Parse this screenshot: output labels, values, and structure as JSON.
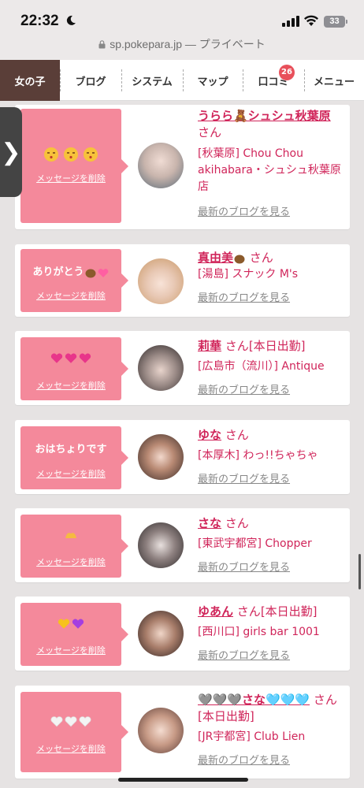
{
  "status": {
    "time": "22:32",
    "battery": "33"
  },
  "browser": {
    "url": "sp.pokepara.jp",
    "privacy": "— プライベート"
  },
  "nav": {
    "items": [
      {
        "label": "女の子"
      },
      {
        "label": "ブログ"
      },
      {
        "label": "システム"
      },
      {
        "label": "マップ"
      },
      {
        "label": "口コミ",
        "badge": "26"
      },
      {
        "label": "メニュー"
      }
    ]
  },
  "drawer": {
    "label": "❯"
  },
  "cards": [
    {
      "message": "",
      "delete_label": "メッセージを削除",
      "name": "うらら🧸シュシュ秋葉原",
      "honorific": "さん",
      "status": "",
      "shop": "[秋葉原] Chou Chou akihabara・シュシュ秋葉原店",
      "blog_label": "最新のブログを見る"
    },
    {
      "message": "ありがとう",
      "delete_label": "メッセージを削除",
      "name": "真由美",
      "honorific": "さん",
      "status": "",
      "shop": "[湯島] スナック M's",
      "blog_label": "最新のブログを見る"
    },
    {
      "message": "",
      "delete_label": "メッセージを削除",
      "name": "莉華",
      "honorific": "さん",
      "status": "[本日出勤]",
      "shop": "[広島市（流川）] Antique",
      "blog_label": "最新のブログを見る"
    },
    {
      "message": "おはちょりです",
      "delete_label": "メッセージを削除",
      "name": "ゆな",
      "honorific": "さん",
      "status": "",
      "shop": "[本厚木] わっ!!ちゃちゃ",
      "blog_label": "最新のブログを見る"
    },
    {
      "message": "",
      "delete_label": "メッセージを削除",
      "name": "さな",
      "honorific": "さん",
      "status": "",
      "shop": "[東武宇都宮] Chopper",
      "blog_label": "最新のブログを見る"
    },
    {
      "message": "",
      "delete_label": "メッセージを削除",
      "name": "ゆあん",
      "honorific": "さん",
      "status": "[本日出勤]",
      "shop": "[西川口] girls bar 1001",
      "blog_label": "最新のブログを見る"
    },
    {
      "message": "",
      "delete_label": "メッセージを削除",
      "name": "🩶🩶🩶さな🩵🩵🩵",
      "honorific": "さん",
      "status": "[本日出勤]",
      "shop": "[JR宇都宮] Club Lien",
      "blog_label": "最新のブログを見る"
    }
  ],
  "colors": {
    "accent": "#d0255a",
    "bubble": "#f4899b",
    "nav_active": "#5a3e38",
    "badge": "#e8505b"
  }
}
